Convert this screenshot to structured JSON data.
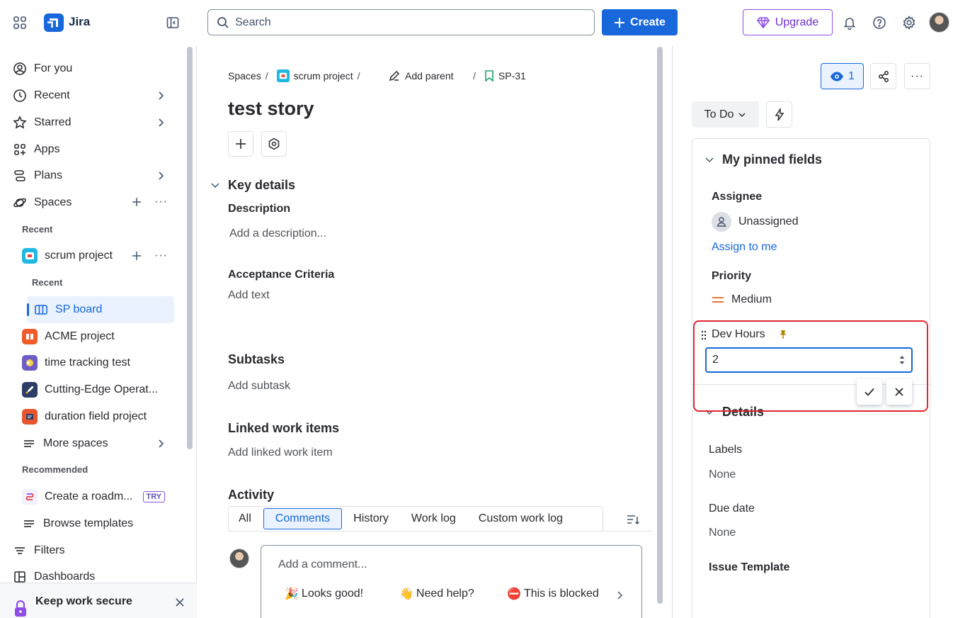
{
  "topbar": {
    "app_name": "Jira",
    "search_placeholder": "Search",
    "create_label": "Create",
    "upgrade_label": "Upgrade"
  },
  "sidebar": {
    "nav": [
      {
        "label": "For you",
        "icon": "user-circle-icon"
      },
      {
        "label": "Recent",
        "icon": "clock-icon"
      },
      {
        "label": "Starred",
        "icon": "star-icon"
      },
      {
        "label": "Apps",
        "icon": "apps-icon"
      },
      {
        "label": "Plans",
        "icon": "plans-icon"
      },
      {
        "label": "Spaces",
        "icon": "spaces-icon"
      }
    ],
    "recent_label": "Recent",
    "scrum_project": "scrum project",
    "recent_sub_label": "Recent",
    "sp_board": "SP board",
    "spaces": [
      {
        "label": "ACME project",
        "color": "#f15b2a"
      },
      {
        "label": "time tracking test",
        "color": "#6e5dc6"
      },
      {
        "label": "Cutting-Edge Operat...",
        "color": "#2c3e66"
      },
      {
        "label": "duration field project",
        "color": "#e8552c"
      }
    ],
    "more_spaces": "More spaces",
    "recommended_label": "Recommended",
    "roadmap": "Create a roadm...",
    "try_badge": "TRY",
    "browse_templates": "Browse templates",
    "filters": "Filters",
    "dashboards": "Dashboards",
    "secure_title": "Keep work secure"
  },
  "main": {
    "breadcrumb": {
      "spaces": "Spaces",
      "project": "scrum project",
      "add_parent": "Add parent",
      "key": "SP-31"
    },
    "title": "test story",
    "key_details": "Key details",
    "description_label": "Description",
    "description_placeholder": "Add a description...",
    "acceptance_label": "Acceptance Criteria",
    "acceptance_placeholder": "Add text",
    "subtasks_label": "Subtasks",
    "subtasks_placeholder": "Add subtask",
    "linked_label": "Linked work items",
    "linked_placeholder": "Add linked work item",
    "activity_label": "Activity",
    "tabs": [
      "All",
      "Comments",
      "History",
      "Work log",
      "Custom work log"
    ],
    "active_tab": "Comments",
    "comment_placeholder": "Add a comment...",
    "quick_replies": [
      {
        "emoji": "🎉",
        "label": "Looks good!"
      },
      {
        "emoji": "👋",
        "label": "Need help?"
      },
      {
        "emoji": "⛔",
        "label": "This is blocked"
      }
    ]
  },
  "right": {
    "watchers": "1",
    "status": "To Do",
    "pinned_title": "My pinned fields",
    "assignee_label": "Assignee",
    "assignee_value": "Unassigned",
    "assign_to_me": "Assign to me",
    "priority_label": "Priority",
    "priority_value": "Medium",
    "dev_hours_label": "Dev Hours",
    "dev_hours_value": "2",
    "details_title": "Details",
    "labels_label": "Labels",
    "labels_value": "None",
    "due_label": "Due date",
    "due_value": "None",
    "template_label": "Issue Template"
  },
  "colors": {
    "brand": "#1868db",
    "upgrade": "#8f4ee8",
    "highlight": "#e0262e",
    "priority_medium": "#e2792f"
  }
}
